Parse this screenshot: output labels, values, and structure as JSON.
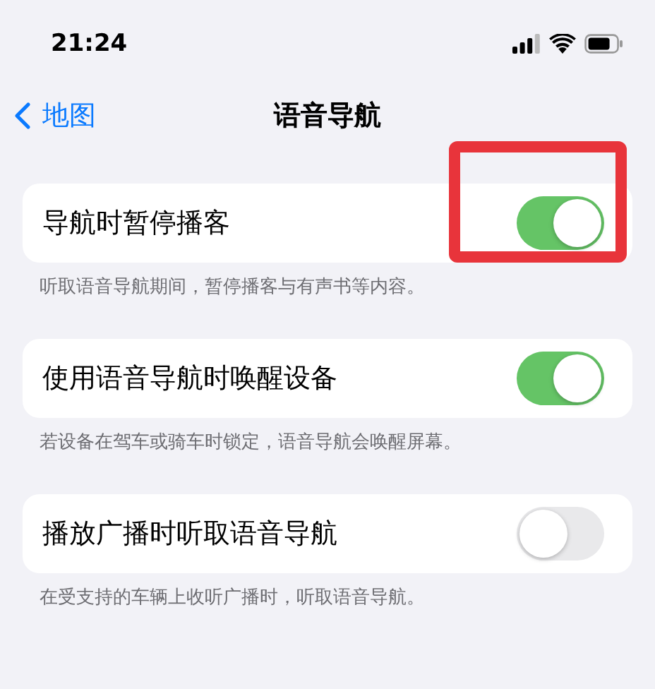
{
  "status_bar": {
    "time": "21:24"
  },
  "nav": {
    "back_label": "地图",
    "title": "语音导航"
  },
  "groups": [
    {
      "label": "导航时暂停播客",
      "on": true,
      "highlighted": true,
      "footer": "听取语音导航期间，暂停播客与有声书等内容。"
    },
    {
      "label": "使用语音导航时唤醒设备",
      "on": true,
      "highlighted": false,
      "footer": "若设备在驾车或骑车时锁定，语音导航会唤醒屏幕。"
    },
    {
      "label": "播放广播时听取语音导航",
      "on": false,
      "highlighted": false,
      "footer": "在受支持的车辆上收听广播时，听取语音导航。"
    }
  ]
}
